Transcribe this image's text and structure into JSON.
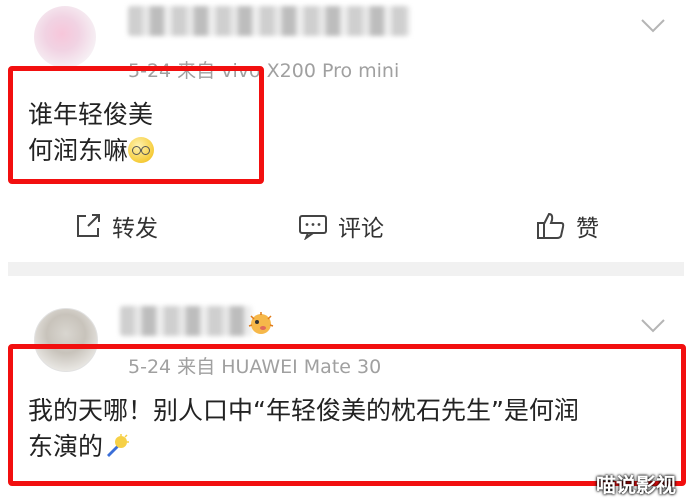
{
  "post1": {
    "meta": "5-24  来自 vivo X200 Pro mini",
    "text_line1": "谁年轻俊美",
    "text_line2": "何润东嘛"
  },
  "actions": {
    "repost": "转发",
    "comment": "评论",
    "like": "赞"
  },
  "post2": {
    "meta": "5-24  来自 HUAWEI Mate 30",
    "text_line1": "我的天哪！别人口中“年轻俊美的枕石先生”是何润",
    "text_line2": "东演的"
  },
  "watermark": "喵说影视",
  "colors": {
    "highlight_border": "#f20f0f",
    "meta_gray": "#a0a0a0"
  },
  "icons": [
    "chevron-down-icon",
    "share-icon",
    "comment-icon",
    "like-icon",
    "glasses-emoji-icon",
    "torch-emoji-icon",
    "pufferfish-badge-icon"
  ]
}
